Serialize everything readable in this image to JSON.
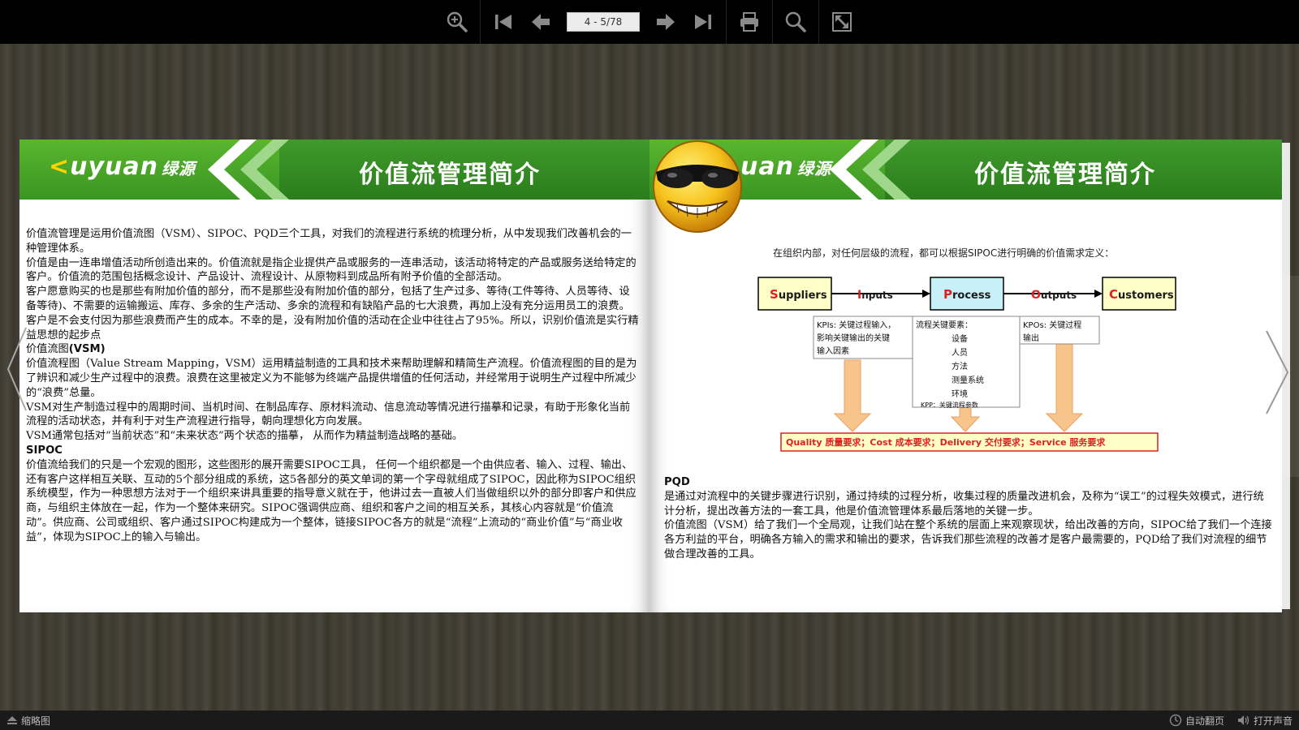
{
  "toolbar": {
    "zoom_in_icon": "zoom-in-icon",
    "page_value": "4 - 5/78"
  },
  "left_page": {
    "logo_text_main": "uyuan",
    "logo_text_k": "<",
    "logo_cn": "绿源",
    "title": "价值流管理简介",
    "paragraphs": [
      "价值流管理是运用价值流图（VSM）、SIPOC、PQD三个工具，对我们的流程进行系统的梳理分析，从中发现我们改善机会的一种管理体系。",
      "价值是由一连串增值活动所创造出来的。价值流就是指企业提供产品或服务的一连串活动，该活动将特定的产品或服务送给特定的客户。价值流的范围包括概念设计、产品设计、流程设计、从原物料到成品所有附予价值的全部活动。",
      "客户愿意购买的也是那些有附加价值的部分，而不是那些没有附加价值的部分，包括了生产过多、等待(工件等待、人员等待、设备等待)、不需要的运输搬运、库存、多余的生产活动、多余的流程和有缺陷产品的七大浪费，再加上没有充分运用员工的浪费。客户是不会支付因为那些浪费而产生的成本。不幸的是，没有附加价值的活动在企业中往往占了95%。所以，识别价值流是实行精益思想的起步点"
    ],
    "vsm_heading_prefix": "价值流图",
    "vsm_heading_bold": "(VSM)",
    "vsm_paragraphs": [
      "价值流程图（Value Stream Mapping，VSM）运用精益制造的工具和技术来帮助理解和精简生产流程。价值流程图的目的是为了辨识和减少生产过程中的浪费。浪费在这里被定义为不能够为终端产品提供增值的任何活动，并经常用于说明生产过程中所减少的“浪费”总量。",
      "VSM对生产制造过程中的周期时间、当机时间、在制品库存、原材料流动、信息流动等情况进行描摹和记录，有助于形象化当前流程的活动状态，并有利于对生产流程进行指导，朝向理想化方向发展。",
      "VSM通常包括对“当前状态”和“未来状态”两个状态的描摹， 从而作为精益制造战略的基础。"
    ],
    "sipoc_heading": "SIPOC",
    "sipoc_paragraph": "价值流给我们的只是一个宏观的图形，这些图形的展开需要SIPOC工具， 任何一个组织都是一个由供应者、输入、过程、输出、还有客户这样相互关联、互动的5个部分组成的系统，这5各部分的英文单词的第一个字母就组成了SIPOC，因此称为SIPOC组织系统模型，作为一种思想方法对于一个组织来讲具重要的指导意义就在于，他讲过去一直被人们当做组织以外的部分即客户和供应商，与组织主体放在一起，作为一个整体来研究。SIPOC强调供应商、组织和客户之间的相互关系，其核心内容就是“价值流动”。供应商、公司或组织、客户通过SIPOC构建成为一个整体，链接SIPOC各方的就是“流程”上流动的“商业价值”与“商业收益”，体现为SIPOC上的输入与输出。"
  },
  "right_page": {
    "logo_text_main": "uan",
    "logo_cn": "绿源",
    "title": "价值流管理简介",
    "diagram": {
      "caption": "在组织内部，对任何层级的流程，都可以根据SIPOC进行明确的价值需求定义：",
      "boxes": {
        "suppliers_first": "S",
        "suppliers_rest": "uppliers",
        "process_first": "P",
        "process_rest": "rocess",
        "customers_first": "C",
        "customers_rest": "ustomers"
      },
      "arrows": {
        "inputs_first": "I",
        "inputs_rest": "nputs",
        "outputs_first": "O",
        "outputs_rest": "utputs"
      },
      "kpis": {
        "lines": [
          "KPIs: 关键过程输入，",
          "影响关键输出的关键",
          "输入因素"
        ]
      },
      "process_elements": {
        "lines": [
          "流程关键要素：",
          "设备",
          "人员",
          "方法",
          "测量系统",
          "环境",
          "KPP：关键流程参数"
        ]
      },
      "kpos": {
        "lines": [
          "KPOs: 关键过程",
          "输出"
        ]
      },
      "bottom_bar": "Quality 质量要求；Cost 成本要求；Delivery 交付要求；Service 服务要求"
    },
    "pqd_heading": "PQD",
    "pqd_paragraphs": [
      "是通过对流程中的关键步骤进行识别，通过持续的过程分析，收集过程的质量改进机会，及称为“误工”的过程失效模式，进行统计分析，提出改善方法的一套工具，他是价值流管理体系最后落地的关键一步。",
      "价值流图（VSM）给了我们一个全局观，让我们站在整个系统的层面上来观察现状，给出改善的方向，SIPOC给了我们一个连接各方利益的平台，明确各方输入的需求和输出的要求，告诉我们那些流程的改善才是客户最需要的，PQD给了我们对流程的细节做合理改善的工具。"
    ]
  },
  "bottombar": {
    "thumbnails_label": "缩略图",
    "autoflip_label": "自动翻页",
    "sound_label": "打开声音"
  },
  "colors": {
    "header_green": "#2b7d1c",
    "logo_green": "#5ab52f",
    "box_yellow": "#ffffc8",
    "box_blue": "#c8f0f8",
    "arrow_orange": "#f7c48c",
    "red_letter": "#e02020"
  }
}
